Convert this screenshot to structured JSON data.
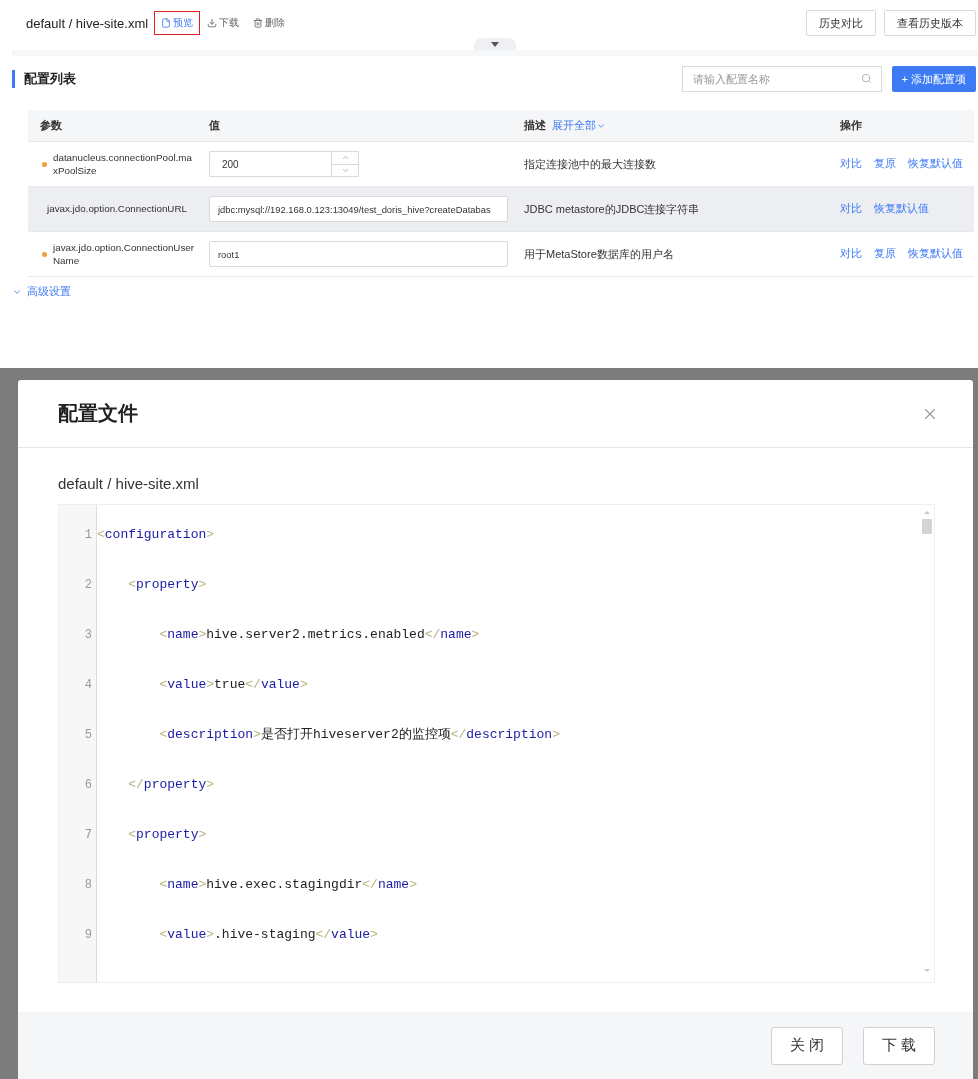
{
  "file_header": {
    "path": "default / hive-site.xml",
    "actions": [
      {
        "kind": "preview",
        "label": "预览",
        "selected": true
      },
      {
        "kind": "download",
        "label": "下载",
        "selected": false
      },
      {
        "kind": "delete",
        "label": "删除",
        "selected": false
      }
    ],
    "buttons": [
      "历史对比",
      "查看历史版本"
    ]
  },
  "config_list": {
    "title": "配置列表",
    "search": {
      "placeholder": "请输入配置名称"
    },
    "add_button": "+ 添加配置项",
    "columns": [
      {
        "label": "参数"
      },
      {
        "label": "值"
      },
      {
        "label": "描述",
        "link": "展开全部"
      },
      {
        "label": "操作"
      }
    ],
    "rows": [
      {
        "param": "datanucleus.connectionPool.maxPoolSize",
        "modified": true,
        "kind": "number",
        "value": "200",
        "description": "指定连接池中的最大连接数",
        "highlighted": false,
        "actions": [
          "对比",
          "复原",
          "恢复默认值"
        ]
      },
      {
        "param": "javax.jdo.option.ConnectionURL",
        "modified": false,
        "kind": "text",
        "value": "jdbc:mysql://192.168.0.123:13049/test_doris_hive?createDatabas",
        "description": "JDBC metastore的JDBC连接字符串",
        "highlighted": true,
        "actions": [
          "对比",
          "恢复默认值"
        ]
      },
      {
        "param": "javax.jdo.option.ConnectionUserName",
        "modified": true,
        "kind": "text",
        "value": "root1",
        "description": "用于MetaStore数据库的用户名",
        "highlighted": false,
        "actions": [
          "对比",
          "复原",
          "恢复默认值"
        ]
      }
    ],
    "advanced": {
      "label": "高级设置",
      "expanded": false
    }
  },
  "modal": {
    "title": "配置文件",
    "subtitle": "default / hive-site.xml",
    "code_lines": [
      {
        "number": "1",
        "code": "<configuration>"
      },
      {
        "number": "2",
        "code": "    <property>"
      },
      {
        "number": "3",
        "code": "        <name>hive.server2.metrics.enabled</name>"
      },
      {
        "number": "4",
        "code": "        <value>true</value>"
      },
      {
        "number": "5",
        "code": "        <description>是否打开hiveserver2的监控项</description>"
      },
      {
        "number": "6",
        "code": "    </property>"
      },
      {
        "number": "7",
        "code": "    <property>"
      },
      {
        "number": "8",
        "code": "        <name>hive.exec.stagingdir</name>"
      },
      {
        "number": "9",
        "code": "        <value>.hive-staging</value>"
      }
    ],
    "buttons": [
      "关 闭",
      "下 载"
    ]
  }
}
